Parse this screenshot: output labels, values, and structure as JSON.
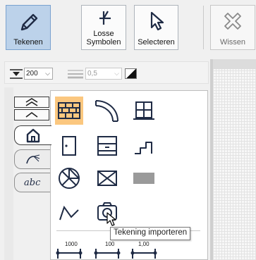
{
  "toolbar": {
    "tekenen": "Tekenen",
    "losse_symbolen": "Losse\nSymbolen",
    "selecteren": "Selecteren",
    "wissen": "Wissen"
  },
  "options": {
    "scale_value": "200",
    "line_width_value": "0,5"
  },
  "tooltip": "Tekening importeren",
  "dimensions": [
    "1000",
    "100",
    "1,00"
  ],
  "colors": {
    "active_button": "#bcd2ea",
    "selected_symbol": "#fbc77f",
    "symbol_stroke": "#1f2b45"
  }
}
